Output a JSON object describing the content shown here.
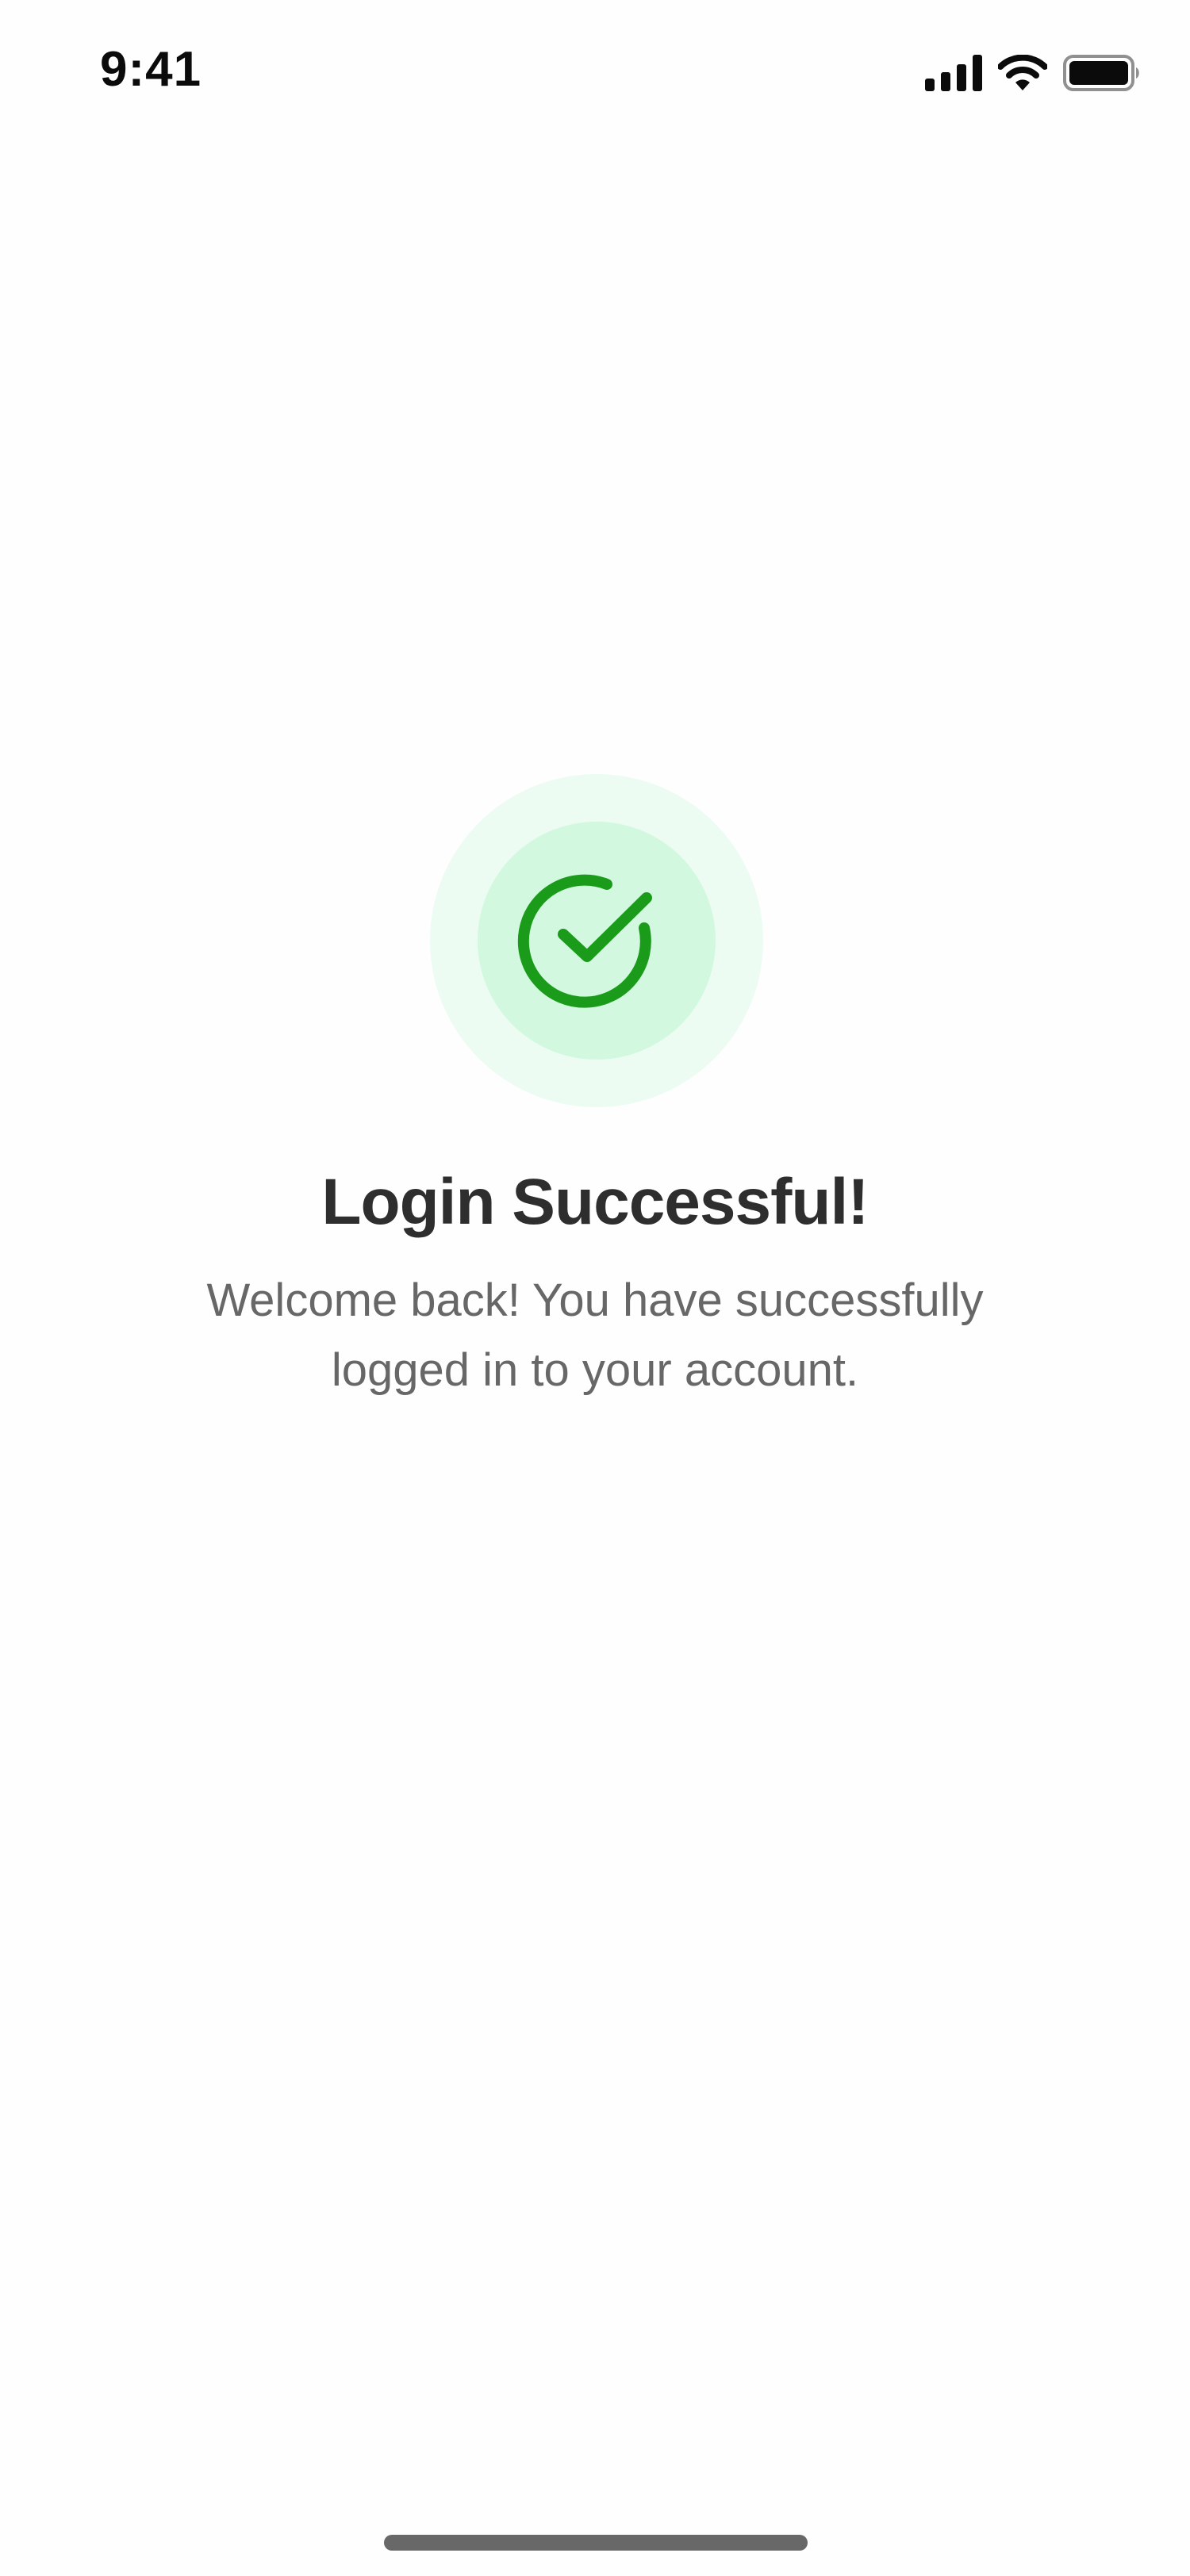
{
  "status_bar": {
    "time": "9:41",
    "icons": [
      "signal-icon",
      "wifi-icon",
      "battery-icon"
    ]
  },
  "success": {
    "icon": "check-circle-icon",
    "title": "Login Successful!",
    "message": "Welcome back! You have successfully logged in to your account."
  },
  "colors": {
    "accent_green": "#1a9b1a",
    "halo_outer": "#ecfcf2",
    "halo_inner": "#d3f8e0",
    "title_text": "#2e2e2e",
    "body_text": "#676767"
  }
}
